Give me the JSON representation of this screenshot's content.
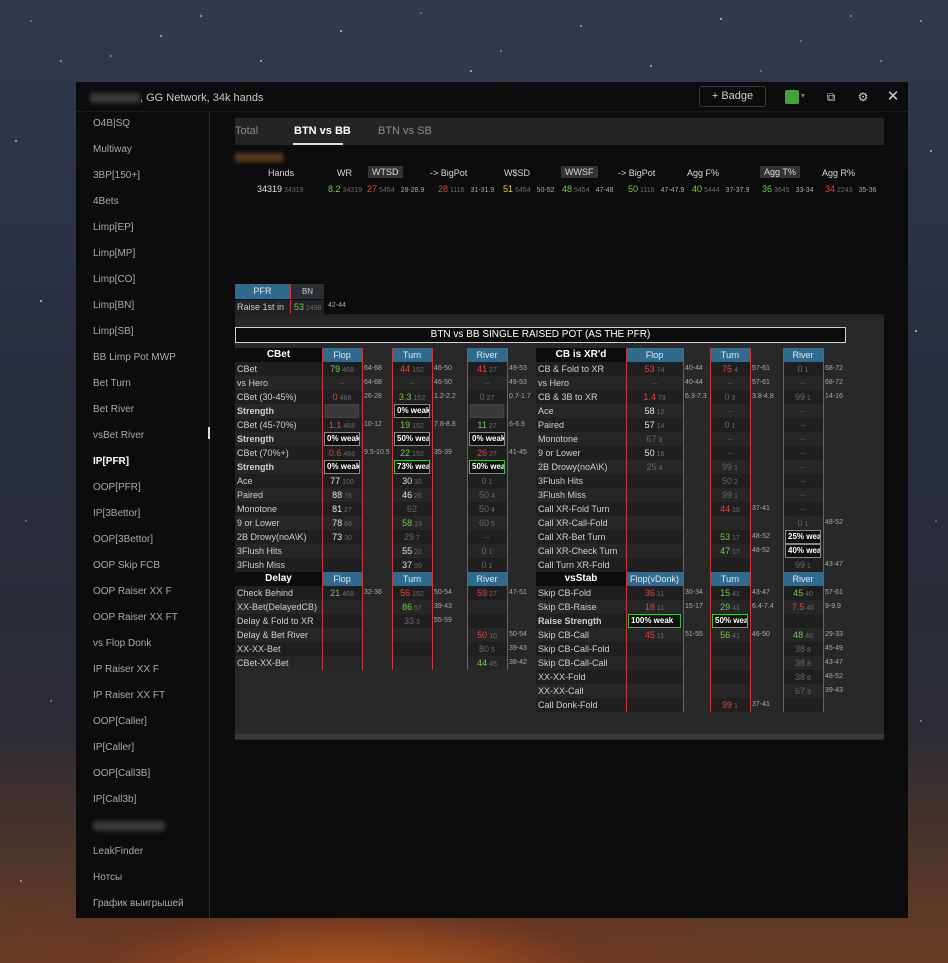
{
  "window": {
    "title": "GG Network, 34k hands",
    "badge_label": "+ Badge",
    "color_swatch": "#3fa33a"
  },
  "sidebar": {
    "items": [
      "O4B|SQ",
      "Multiway",
      "3BP[150+]",
      "4Bets",
      "Limp[EP]",
      "Limp[MP]",
      "Limp[CO]",
      "Limp[BN]",
      "Limp[SB]",
      "BB Limp Pot MWP",
      "Bet Turn",
      "Bet River",
      "vsBet River",
      "IP[PFR]",
      "OOP[PFR]",
      "IP[3Bettor]",
      "OOP[3Bettor]",
      "OOP Skip FCB",
      "OOP Raiser XX F",
      "OOP Raiser XX FT",
      "vs Flop Donk",
      "IP Raiser XX F",
      "IP Raiser XX FT",
      "OOP[Caller]",
      "IP[Caller]",
      "OOP[Call3B]",
      "IP[Call3b]",
      "",
      "LeakFinder",
      "Нотсы",
      "График выигрышей"
    ],
    "active": "IP[PFR]"
  },
  "tabs": [
    "Total",
    "BTN vs BB",
    "BTN vs SB"
  ],
  "active_tab": "BTN vs BB",
  "summary": {
    "headers": [
      "Hands",
      "WR",
      "WTSD",
      "-> BigPot",
      "W$SD",
      "WWSF",
      "-> BigPot",
      "Agg F%",
      "Agg T%",
      "Agg R%"
    ],
    "hands": "34319",
    "hands_sub": "34319",
    "wr": "8.2",
    "wr_sub": "34319",
    "wtsd": "27",
    "wtsd_sub": "5454",
    "wtsd_rng": "28-28.9",
    "bp1": "28",
    "bp1_sub": "1116",
    "bp1_rng": "31-31.9",
    "wsd": "51",
    "wsd_sub": "5454",
    "wsd_rng": "50-52",
    "wwsf": "48",
    "wwsf_sub": "5454",
    "wwsf_rng": "47-48",
    "bp2": "50",
    "bp2_sub": "1116",
    "bp2_rng": "47-47.9",
    "aggf": "40",
    "aggf_sub": "5444",
    "aggf_rng": "37-37.9",
    "aggt": "36",
    "aggt_sub": "3645",
    "aggt_rng": "33-34",
    "aggr": "34",
    "aggr_sub": "2243",
    "aggr_rng": "35-36"
  },
  "pfr": {
    "tab1": "PFR",
    "tab2": "BN",
    "label": "Raise 1st in",
    "value": "53",
    "sub": "2498",
    "rng": "42-44"
  },
  "grid_title": "BTN vs BB SINGLE RAISED POT (AS THE PFR)",
  "cbet": {
    "head": "CBet",
    "cols": [
      "Flop",
      "Turn",
      "River"
    ],
    "rows": [
      [
        "CBet",
        "79",
        "468",
        "64-68",
        "44",
        "152",
        "46-50",
        "41",
        "27",
        "49-53"
      ],
      [
        "vs Hero",
        "--",
        "",
        "64-68",
        "--",
        "",
        "46-50",
        "--",
        "",
        "49-53"
      ],
      [
        "CBet (30-45%)",
        "0",
        "468",
        "26-28",
        "3.3",
        "152",
        "1.2-2.2",
        "0",
        "27",
        "0.7-1.7"
      ],
      [
        "Strength",
        "",
        "",
        "",
        "0% weak",
        "",
        "",
        "",
        "",
        ""
      ],
      [
        "CBet (45-70%)",
        "1.1",
        "468",
        "10-12",
        "19",
        "152",
        "7.8-8.8",
        "11",
        "27",
        "6-6.9"
      ],
      [
        "Strength",
        "0% weak",
        "",
        "",
        "50% weak",
        "",
        "",
        "0% weak",
        "",
        ""
      ],
      [
        "CBet (70%+)",
        "0.6",
        "468",
        "9.5-10.5",
        "22",
        "152",
        "35-39",
        "26",
        "27",
        "41-45"
      ],
      [
        "Strength",
        "0% weak",
        "",
        "",
        "73% weak",
        "",
        "",
        "50% weak",
        "",
        ""
      ],
      [
        "Ace",
        "77",
        "100",
        "",
        "30",
        "33",
        "",
        "0",
        "1",
        ""
      ],
      [
        "Paired",
        "88",
        "76",
        "",
        "46",
        "26",
        "",
        "50",
        "4",
        ""
      ],
      [
        "Monotone",
        "81",
        "27",
        "",
        "62",
        "",
        "",
        "50",
        "4",
        ""
      ],
      [
        "9 or Lower",
        "78",
        "68",
        "",
        "58",
        "19",
        "",
        "60",
        "5",
        ""
      ],
      [
        "2B Drowy(noA\\K)",
        "73",
        "30",
        "",
        "29",
        "7",
        "",
        "--",
        "",
        ""
      ],
      [
        "3Flush Hits",
        "",
        "",
        "",
        "55",
        "22",
        "",
        "0",
        "1",
        ""
      ],
      [
        "3Flush Miss",
        "",
        "",
        "",
        "37",
        "59",
        "",
        "0",
        "1",
        ""
      ]
    ]
  },
  "xr": {
    "head": "CB is XR'd",
    "cols": [
      "Flop",
      "Turn",
      "River"
    ],
    "rows": [
      [
        "CB & Fold to XR",
        "53",
        "74",
        "40-44",
        "75",
        "4",
        "57-61",
        "0",
        "1",
        "68-72"
      ],
      [
        "vs Hero",
        "--",
        "",
        "40-44",
        "--",
        "",
        "57-61",
        "--",
        "",
        "68-72"
      ],
      [
        "CB & 3B to XR",
        "1.4",
        "73",
        "6.3-7.3",
        "0",
        "3",
        "3.8-4.8",
        "99",
        "1",
        "14-16"
      ],
      [
        "Ace",
        "58",
        "12",
        "",
        "--",
        "",
        "",
        "--",
        "",
        ""
      ],
      [
        "Paired",
        "57",
        "14",
        "",
        "0",
        "1",
        "",
        "--",
        "",
        ""
      ],
      [
        "Monotone",
        "67",
        "3",
        "",
        "--",
        "",
        "",
        "--",
        "",
        ""
      ],
      [
        "9 or Lower",
        "50",
        "16",
        "",
        "--",
        "",
        "",
        "--",
        "",
        ""
      ],
      [
        "2B Drowy(noA\\K)",
        "25",
        "4",
        "",
        "99",
        "1",
        "",
        "--",
        "",
        ""
      ],
      [
        "3Flush Hits",
        "",
        "",
        "",
        "50",
        "2",
        "",
        "--",
        "",
        ""
      ],
      [
        "3Flush Miss",
        "",
        "",
        "",
        "99",
        "1",
        "",
        "--",
        "",
        ""
      ],
      [
        "Call XR-Fold Turn",
        "",
        "",
        "",
        "44",
        "16",
        "37-41",
        "--",
        "",
        ""
      ],
      [
        "Call XR-Call-Fold",
        "",
        "",
        "",
        "",
        "",
        "",
        "0",
        "1",
        "48-52"
      ],
      [
        "Call XR-Bet Turn",
        "",
        "",
        "",
        "53",
        "17",
        "48-52",
        "25% weak",
        "",
        ""
      ],
      [
        "Call XR-Check Turn",
        "",
        "",
        "",
        "47",
        "17",
        "48-52",
        "40% weak",
        "",
        ""
      ],
      [
        "Call Turn XR-Fold",
        "",
        "",
        "",
        "",
        "",
        "",
        "99",
        "1",
        "43-47"
      ]
    ]
  },
  "delay": {
    "head": "Delay",
    "cols": [
      "Flop",
      "Turn",
      "River"
    ],
    "rows": [
      [
        "Check Behind",
        "21",
        "468",
        "32-36",
        "56",
        "152",
        "50-54",
        "59",
        "27",
        "47-51"
      ],
      [
        "XX-Bet(DelayedCB)",
        "",
        "",
        "",
        "86",
        "57",
        "39-43",
        "",
        "",
        ""
      ],
      [
        "Delay & Fold to XR",
        "",
        "",
        "",
        "33",
        "3",
        "55-59",
        "",
        "",
        ""
      ],
      [
        "Delay & Bet River",
        "",
        "",
        "",
        "",
        "",
        "",
        "50",
        "10",
        "50-54"
      ],
      [
        "XX-XX-Bet",
        "",
        "",
        "",
        "",
        "",
        "",
        "80",
        "5",
        "39-43"
      ],
      [
        "CBet-XX-Bet",
        "",
        "",
        "",
        "",
        "",
        "",
        "44",
        "45",
        "38-42"
      ]
    ]
  },
  "vsstab": {
    "head": "vsStab",
    "cols": [
      "Flop(vDonk)",
      "Turn",
      "River"
    ],
    "rows": [
      [
        "Skip CB-Fold",
        "36",
        "11",
        "30-34",
        "15",
        "41",
        "43-47",
        "45",
        "40",
        "57-61"
      ],
      [
        "Skip CB-Raise",
        "18",
        "11",
        "15-17",
        "29",
        "41",
        "6.4-7.4",
        "7.5",
        "40",
        "9-9.9"
      ],
      [
        "Raise Strength",
        "100% weak",
        "",
        "",
        "50% weak",
        "",
        "",
        "",
        "",
        ""
      ],
      [
        "Skip CB-Call",
        "45",
        "11",
        "51-55",
        "56",
        "41",
        "46-50",
        "48",
        "40",
        "29-33"
      ],
      [
        "Skip CB-Call-Fold",
        "",
        "",
        "",
        "",
        "",
        "",
        "38",
        "8",
        "45-49"
      ],
      [
        "Skip CB-Call-Call",
        "",
        "",
        "",
        "",
        "",
        "",
        "38",
        "8",
        "43-47"
      ],
      [
        "XX-XX-Fold",
        "",
        "",
        "",
        "",
        "",
        "",
        "38",
        "8",
        "48-52"
      ],
      [
        "XX-XX-Call",
        "",
        "",
        "",
        "",
        "",
        "",
        "67",
        "3",
        "39-43"
      ],
      [
        "Call Donk-Fold",
        "",
        "",
        "",
        "99",
        "1",
        "37-41",
        "",
        "",
        ""
      ]
    ]
  }
}
